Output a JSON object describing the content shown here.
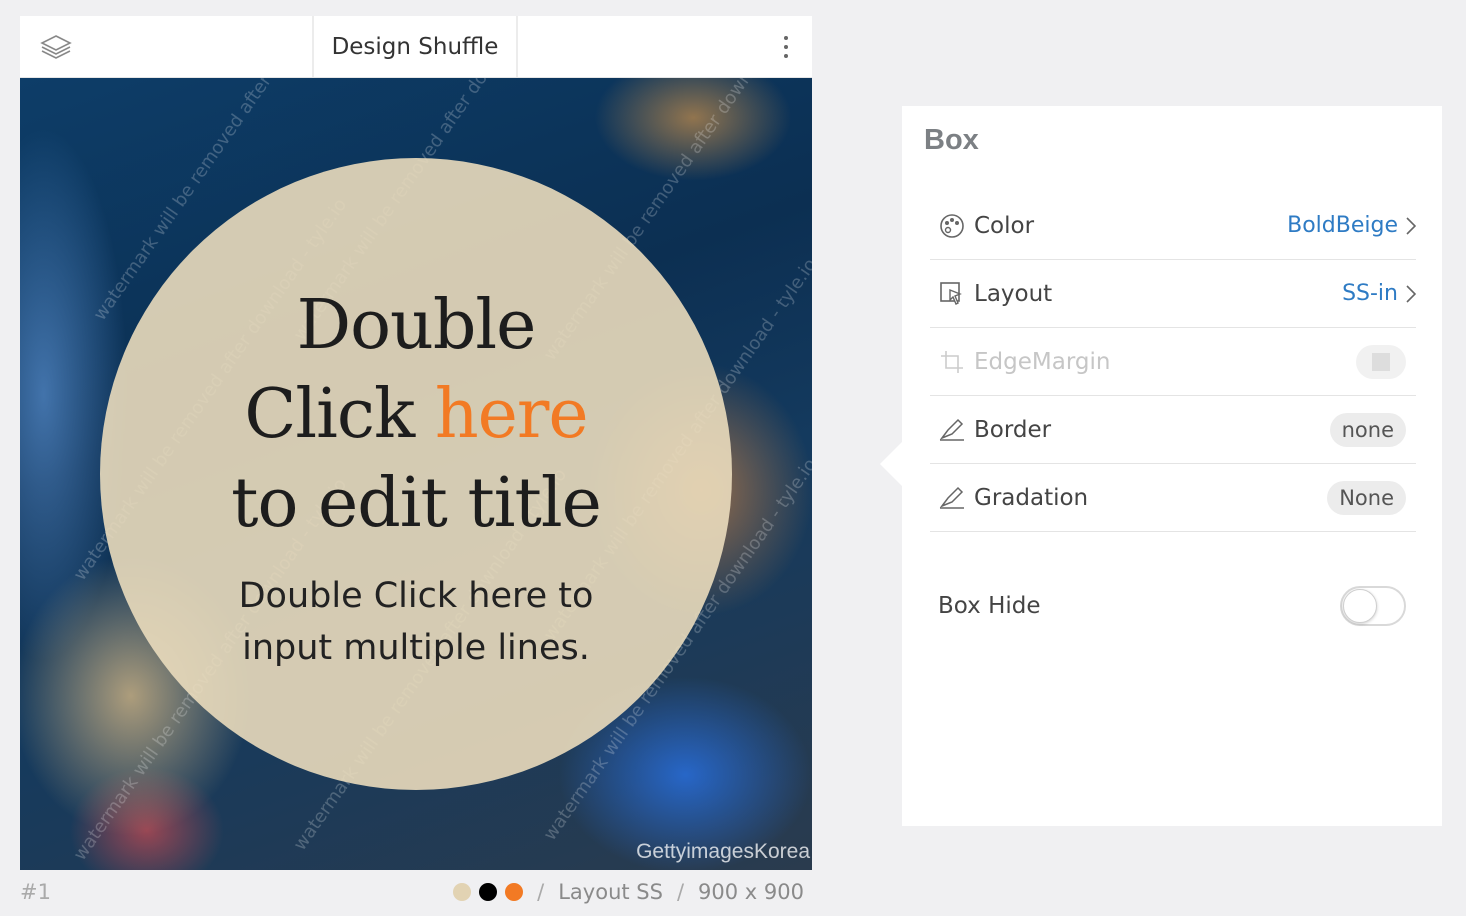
{
  "toolbar": {
    "title": "Design Shuffle",
    "layers_icon": "layers-icon",
    "more_icon": "more-vertical-icon"
  },
  "canvas": {
    "title_lines": [
      "Double",
      "Click ",
      "here",
      "to edit title"
    ],
    "subtitle_lines": [
      "Double Click here to",
      "input multiple lines."
    ],
    "credit": "GettyimagesKorea",
    "watermark": "watermark will be removed after download - tyle.io",
    "accent_color": "#f27a24",
    "circle_color": "#eadbbc"
  },
  "footer": {
    "index": "#1",
    "swatches": [
      "#e2d3b3",
      "#000000",
      "#f27a24"
    ],
    "separator": "/",
    "layout": "Layout SS",
    "size": "900 x 900"
  },
  "panel": {
    "title": "Box",
    "rows": [
      {
        "label": "Color",
        "value": "BoldBeige",
        "icon": "palette-icon"
      },
      {
        "label": "Layout",
        "value": "SS-in",
        "icon": "pointer-layout-icon"
      },
      {
        "label": "EdgeMargin",
        "value": "",
        "icon": "crop-icon"
      },
      {
        "label": "Border",
        "value": "none",
        "icon": "pen-icon"
      },
      {
        "label": "Gradation",
        "value": "None",
        "icon": "pen-icon"
      }
    ],
    "hide_label": "Box Hide",
    "hide_on": false
  }
}
